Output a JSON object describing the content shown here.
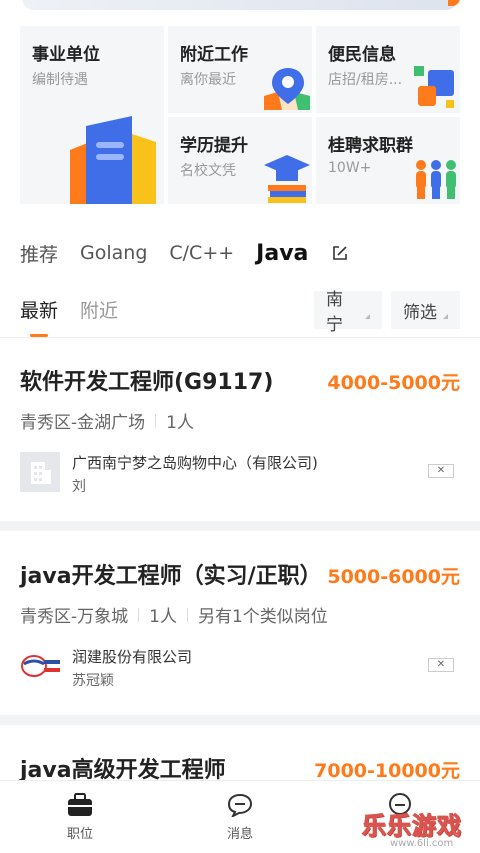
{
  "grid": {
    "tiles": [
      {
        "title": "事业单位",
        "sub": "编制待遇"
      },
      {
        "title": "附近工作",
        "sub": "离你最近"
      },
      {
        "title": "便民信息",
        "sub": "店招/租房..."
      },
      {
        "title": "学历提升",
        "sub": "名校文凭"
      },
      {
        "title": "桂聘求职群",
        "sub": "10W+"
      }
    ]
  },
  "lang_tabs": [
    "推荐",
    "Golang",
    "C/C++",
    "Java"
  ],
  "sort_tabs": [
    "最新",
    "附近"
  ],
  "filters": {
    "city": "南宁",
    "filter": "筛选"
  },
  "jobs": [
    {
      "title": "软件开发工程师(G9117)",
      "salary": "4000-5000元",
      "location": "青秀区-金湖广场",
      "headcount": "1人",
      "extra": "",
      "company": "广西南宁梦之岛购物中心（有限公司)",
      "person": "刘"
    },
    {
      "title": "java开发工程师（实习/正职）",
      "salary": "5000-6000元",
      "location": "青秀区-万象城",
      "headcount": "1人",
      "extra": "另有1个类似岗位",
      "company": "润建股份有限公司",
      "person": "苏冠颖"
    },
    {
      "title": "java高级开发工程师",
      "salary": "7000-10000元"
    }
  ],
  "bottom_nav": {
    "jobs": "职位",
    "messages": "消息"
  },
  "watermark": {
    "main": "乐乐游戏",
    "url": "www.6ll.com"
  },
  "colors": {
    "accent": "#ff7a1a",
    "tile_bg": "#f5f6f8"
  }
}
